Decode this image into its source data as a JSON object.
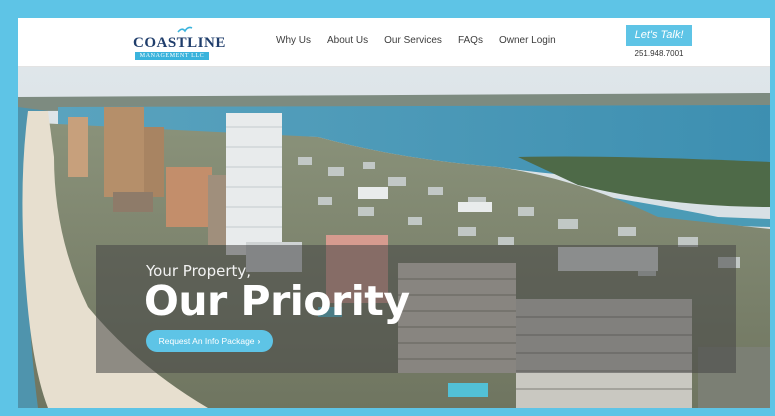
{
  "colors": {
    "frame": "#5ec4e6",
    "accent": "#5ec4e6",
    "navy": "#1f3d6b",
    "ocean": "#3f8fb3"
  },
  "brand": {
    "name": "COASTLINE",
    "subtitle": "MANAGEMENT LLC",
    "bird_icon": "seabird-icon"
  },
  "nav": {
    "items": [
      "Why Us",
      "About Us",
      "Our Services",
      "FAQs",
      "Owner Login"
    ]
  },
  "contact": {
    "cta_label": "Let's Talk!",
    "phone": "251.948.7001"
  },
  "hero": {
    "tagline": "Your Property,",
    "headline": "Our Priority",
    "button_label": "Request An Info Package",
    "button_icon": "chevron-right-icon"
  }
}
